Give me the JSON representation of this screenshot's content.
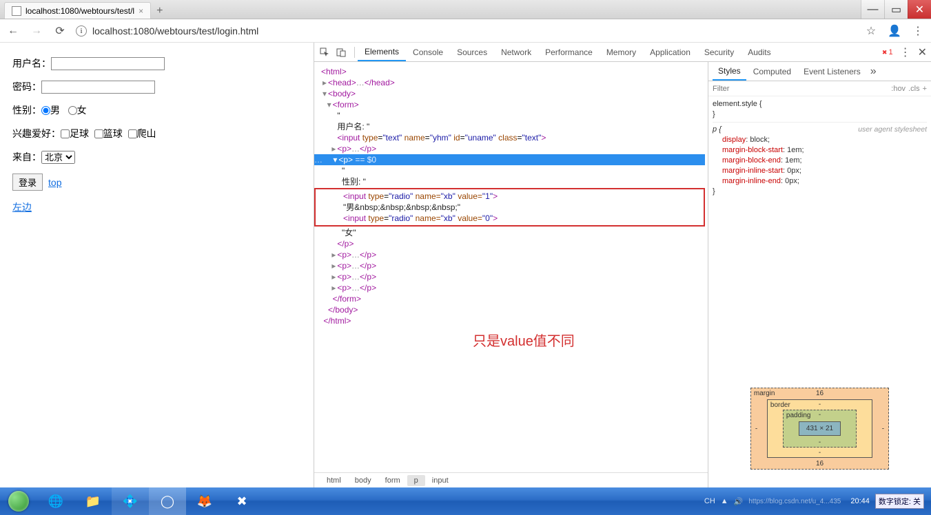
{
  "titlebar": {
    "tab_title": "localhost:1080/webtours/test/l",
    "newtab": "+"
  },
  "addrbar": {
    "url": "localhost:1080/webtours/test/login.html"
  },
  "page": {
    "username_label": "用户名：",
    "password_label": "密码：",
    "gender_label": "性别：",
    "gender_male": "男",
    "gender_female": "女",
    "hobby_label": "兴趣爱好：",
    "hobby_football": "足球",
    "hobby_basketball": "篮球",
    "hobby_climbing": "爬山",
    "from_label": "来自：",
    "from_option": "北京",
    "login_btn": "登录",
    "top_link": "top",
    "left_link": "左边"
  },
  "devtools": {
    "tabs": [
      "Elements",
      "Console",
      "Sources",
      "Network",
      "Performance",
      "Memory",
      "Application",
      "Security",
      "Audits"
    ],
    "err_count": "1",
    "tree": {
      "html_open": "<html>",
      "head": "<head>…</head>",
      "body_open": "<body>",
      "form_open": "<form>",
      "quote1": "\"",
      "user_label": "用户名: \"",
      "input_user": "<input type=\"text\" name=\"yhm\" id=\"uname\" class=\"text\">",
      "p_close1": "<p>…</p>",
      "p_sel": "<p>",
      "sel_after": " == $0",
      "quote2": "\"",
      "gender_label": "性别: \"",
      "input_radio1_pre": "<input type=",
      "radio_t": "\"radio\"",
      "name_t": " name=",
      "xb_t": "\"xb\"",
      "value_t": " value=",
      "v1": "\"1\"",
      "v0": "\"0\"",
      "radio1_full": "<input type=\"radio\" name=\"xb\" value=\"1\">",
      "male_text": "\"男&nbsp;&nbsp;&nbsp;&nbsp;\"",
      "radio0_full": "<input type=\"radio\" name=\"xb\" value=\"0\">",
      "female_text": "\"女\"",
      "p_end": "</p>",
      "p_dots": "<p>…</p>",
      "form_end": "</form>",
      "body_end": "</body>",
      "html_end": "</html>",
      "annotation": "只是value值不同"
    },
    "crumbs": [
      "html",
      "body",
      "form",
      "p",
      "input"
    ]
  },
  "styles": {
    "tabs": [
      "Styles",
      "Computed",
      "Event Listeners"
    ],
    "filter_placeholder": "Filter",
    "hov": ":hov",
    "cls": ".cls",
    "el_style": "element.style {",
    "uas": "user agent stylesheet",
    "rule_sel": "p {",
    "props": [
      [
        "display",
        ": block;"
      ],
      [
        "margin-block-start",
        ": 1em;"
      ],
      [
        "margin-block-end",
        ": 1em;"
      ],
      [
        "margin-inline-start",
        ": 0px;"
      ],
      [
        "margin-inline-end",
        ": 0px;"
      ]
    ],
    "close_brace": "}",
    "box": {
      "margin_label": "margin",
      "margin_top": "16",
      "margin_bottom": "16",
      "margin_lr": "-",
      "border_label": "border",
      "border_v": "-",
      "padding_label": "padding",
      "padding_v": "-",
      "content": "431 × 21"
    }
  },
  "taskbar": {
    "lang": "CH",
    "watermark": "https://blog.csdn.net/u_4...435",
    "time": "20:44",
    "ime": "数字锁定: 关"
  }
}
